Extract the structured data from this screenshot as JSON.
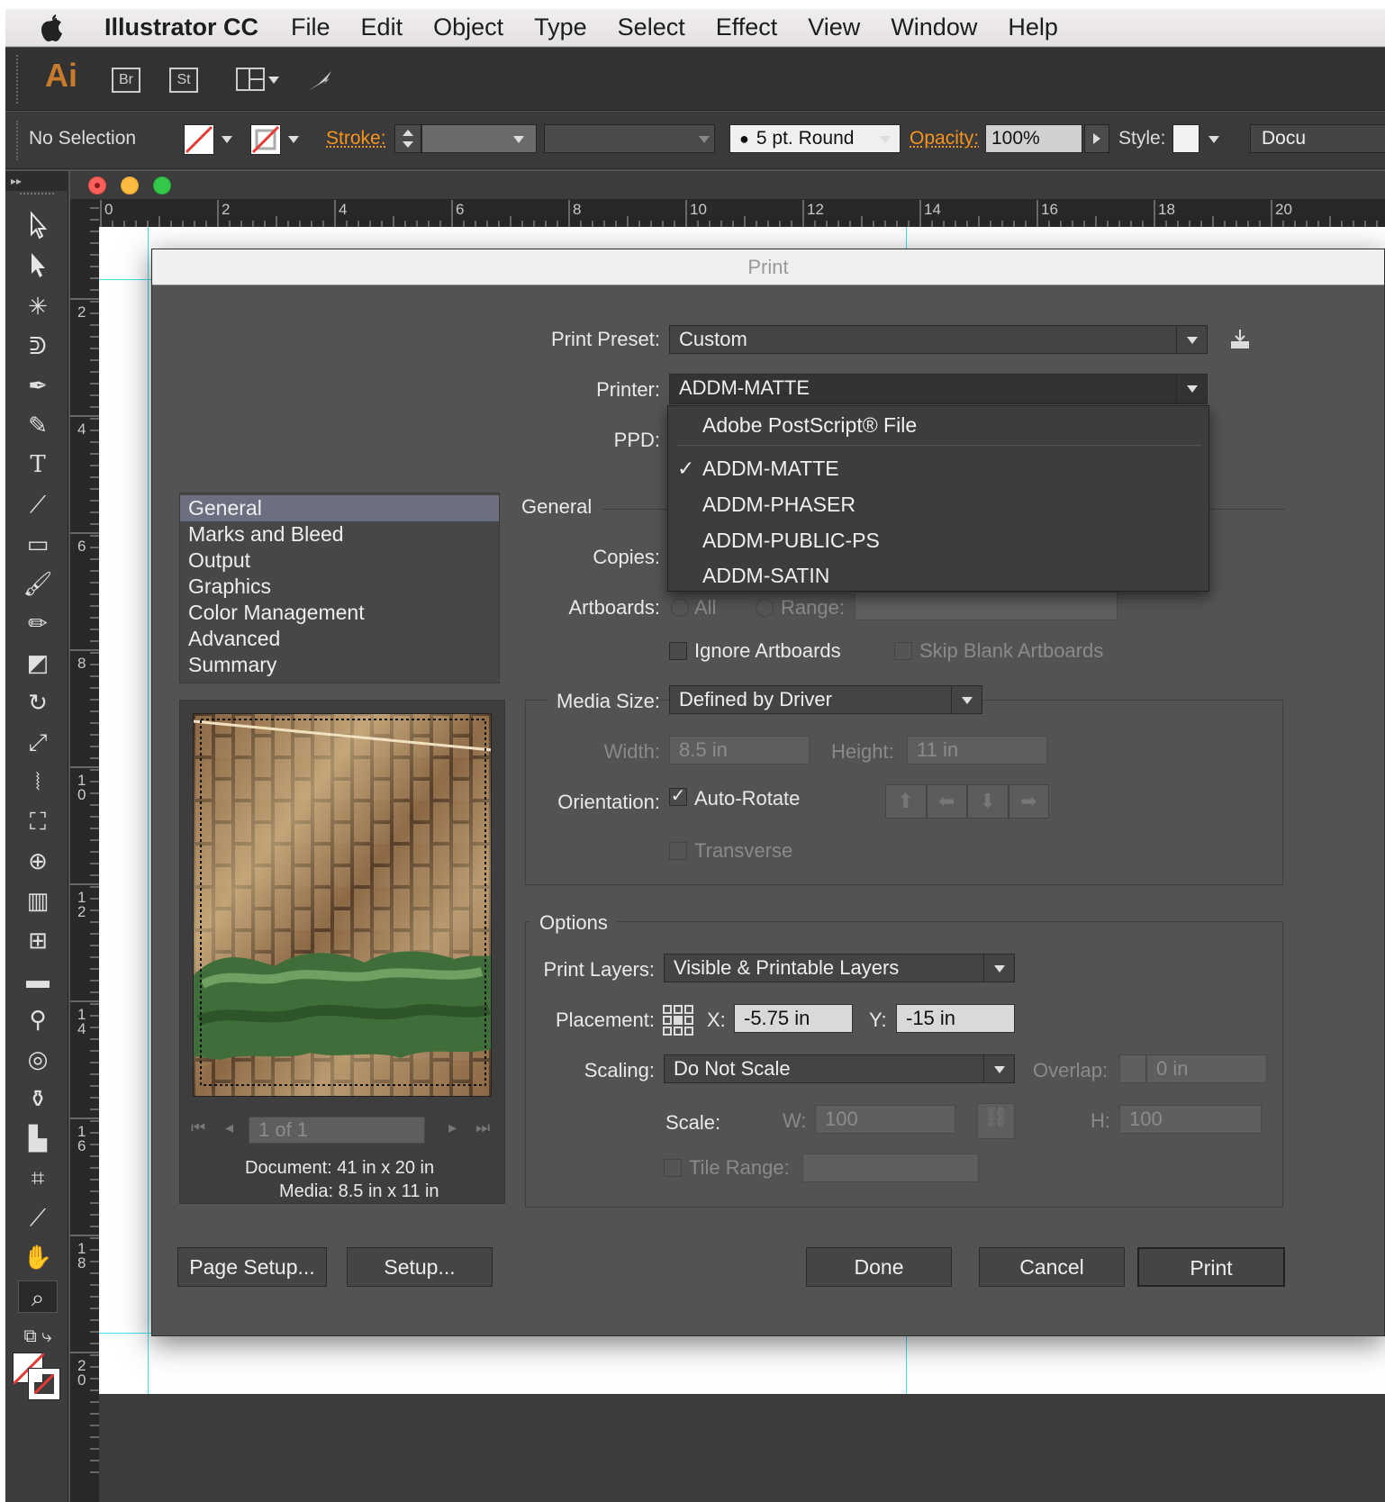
{
  "menubar": {
    "app": "Illustrator CC",
    "items": [
      "File",
      "Edit",
      "Object",
      "Type",
      "Select",
      "Effect",
      "View",
      "Window",
      "Help"
    ]
  },
  "appbar": {
    "logo": "Ai",
    "bridge": "Br",
    "stock": "St"
  },
  "control": {
    "selection": "No Selection",
    "stroke_label": "Stroke:",
    "brush": "5 pt. Round",
    "opacity_label": "Opacity:",
    "opacity": "100%",
    "style_label": "Style:",
    "doc_btn": "Docu"
  },
  "ruler": {
    "h": [
      "0",
      "2",
      "4",
      "6",
      "8",
      "10",
      "12",
      "14",
      "16",
      "18",
      "20"
    ],
    "v": [
      "2",
      "4",
      "6",
      "8",
      "10",
      "12",
      "14",
      "16",
      "18",
      "20"
    ]
  },
  "dialog": {
    "title": "Print",
    "preset_label": "Print Preset:",
    "preset": "Custom",
    "printer_label": "Printer:",
    "printer": "ADDM-MATTE",
    "ppd_label": "PPD:",
    "printer_menu": [
      "Adobe PostScript® File",
      "ADDM-MATTE",
      "ADDM-PHASER",
      "ADDM-PUBLIC-PS",
      "ADDM-SATIN"
    ],
    "categories": [
      "General",
      "Marks and Bleed",
      "Output",
      "Graphics",
      "Color Management",
      "Advanced",
      "Summary"
    ],
    "section": "General",
    "copies_label": "Copies:",
    "artboards_label": "Artboards:",
    "all_label": "All",
    "range_label": "Range:",
    "ignore_artboards": "Ignore Artboards",
    "skip_blank": "Skip Blank Artboards",
    "media_label": "Media Size:",
    "media": "Defined by Driver",
    "width_label": "Width:",
    "width": "8.5 in",
    "height_label": "Height:",
    "height": "11 in",
    "orientation_label": "Orientation:",
    "auto_rotate": "Auto-Rotate",
    "transverse": "Transverse",
    "options_title": "Options",
    "layers_label": "Print Layers:",
    "layers": "Visible & Printable Layers",
    "placement_label": "Placement:",
    "x_label": "X:",
    "x": "-5.75 in",
    "y_label": "Y:",
    "y": "-15 in",
    "scaling_label": "Scaling:",
    "scaling": "Do Not Scale",
    "overlap_label": "Overlap:",
    "overlap": "0 in",
    "scale_label": "Scale:",
    "w_label": "W:",
    "w": "100",
    "h_label": "H:",
    "h": "100",
    "tile_range": "Tile Range:",
    "page_nav": "1 of 1",
    "document_info": "Document: 41 in x 20 in",
    "media_info": "Media: 8.5 in x 11 in",
    "page_setup": "Page Setup...",
    "setup": "Setup...",
    "done": "Done",
    "cancel": "Cancel",
    "print": "Print"
  },
  "colors": {
    "accent": "#f7941d",
    "guide": "#41e0f0",
    "selected": "#6b6f80"
  }
}
